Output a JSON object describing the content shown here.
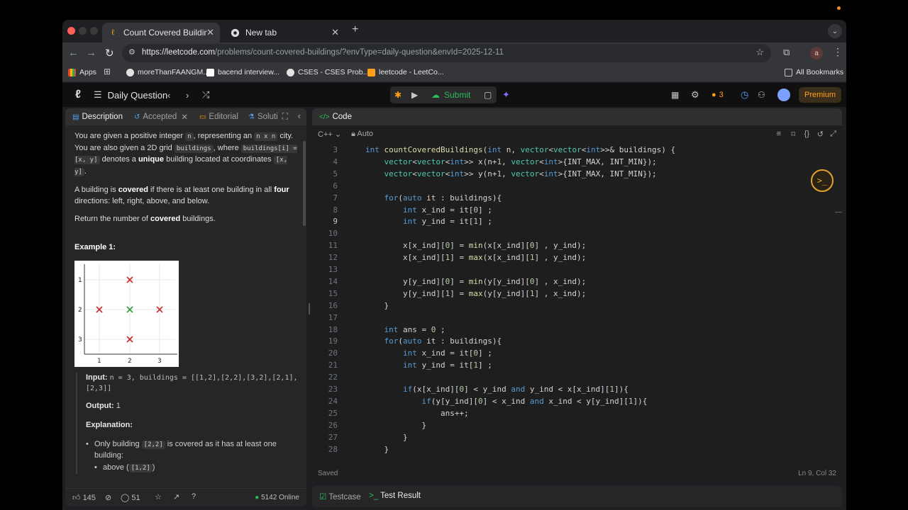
{
  "browser": {
    "tabs": [
      {
        "title": "Count Covered Buildings - Le",
        "active": true
      },
      {
        "title": "New tab",
        "active": false
      }
    ],
    "url_host": "https://leetcode.com",
    "url_path": "/problems/count-covered-buildings/?envType=daily-question&envId=2025-12-11",
    "profile_initial": "a",
    "bookmarks": [
      {
        "label": "Apps"
      },
      {
        "label": "moreThanFAANGM..."
      },
      {
        "label": "bacend interview..."
      },
      {
        "label": "CSES - CSES Prob..."
      },
      {
        "label": "leetcode - LeetCo..."
      }
    ],
    "all_bookmarks": "All Bookmarks"
  },
  "header": {
    "daily_label": "Daily Question",
    "submit_label": "Submit",
    "streak": "3",
    "premium_label": "Premium"
  },
  "left": {
    "tabs": {
      "description": "Description",
      "accepted": "Accepted",
      "editorial": "Editorial",
      "solutions": "Soluti"
    },
    "p1": {
      "t1": "You are given a positive integer ",
      "c1": "n",
      "t2": ", representing an ",
      "c2": "n x n",
      "t3": " city. You are also given a 2D grid ",
      "c3": "buildings",
      "t4": ", where ",
      "c4": "buildings[i] = [x, y]",
      "t5": " denotes a ",
      "b1": "unique",
      "t6": " building located at coordinates ",
      "c5": "[x, y]",
      "t7": "."
    },
    "p2": {
      "t1": "A building is ",
      "b1": "covered",
      "t2": " if there is at least one building in all ",
      "b2": "four",
      "t3": " directions: left, right, above, and below."
    },
    "p3": {
      "t1": "Return the number of ",
      "b1": "covered",
      "t2": " buildings."
    },
    "example_title": "Example 1:",
    "figure": {
      "x_ticks": [
        "1",
        "2",
        "3"
      ],
      "y_ticks": [
        "1",
        "2",
        "3"
      ],
      "covered_color": "#2e9e3a",
      "uncovered_color": "#cc2a2a"
    },
    "input_label": "Input:",
    "input_value": "n = 3, buildings = [[1,2],[2,2],[3,2],[2,1],[2,3]]",
    "output_label": "Output:",
    "output_value": "1",
    "explanation_label": "Explanation:",
    "bullet1_a": "Only building ",
    "bullet1_code": "[2,2]",
    "bullet1_b": " is covered as it has at least one building:",
    "sub1_a": "above (",
    "sub1_code": "[1,2]",
    "sub1_b": ")",
    "footer": {
      "likes": "145",
      "comments": "51",
      "online": "5142 Online"
    }
  },
  "editor": {
    "title": "Code",
    "language": "C++",
    "mode": "Auto",
    "saved": "Saved",
    "cursor": "Ln 9, Col 32",
    "lines": [
      {
        "n": "3",
        "code": "int countCoveredBuildings(int n, vector<vector<int>>& buildings) {"
      },
      {
        "n": "4",
        "code": "    vector<vector<int>> x(n+1, vector<int>{INT_MAX, INT_MIN});"
      },
      {
        "n": "5",
        "code": "    vector<vector<int>> y(n+1, vector<int>{INT_MAX, INT_MIN});"
      },
      {
        "n": "6",
        "code": ""
      },
      {
        "n": "7",
        "code": "    for(auto it : buildings){"
      },
      {
        "n": "8",
        "code": "        int x_ind = it[0] ;"
      },
      {
        "n": "9",
        "code": "        int y_ind = it[1] ;"
      },
      {
        "n": "10",
        "code": ""
      },
      {
        "n": "11",
        "code": "        x[x_ind][0] = min(x[x_ind][0] , y_ind);"
      },
      {
        "n": "12",
        "code": "        x[x_ind][1] = max(x[x_ind][1] , y_ind);"
      },
      {
        "n": "13",
        "code": ""
      },
      {
        "n": "14",
        "code": "        y[y_ind][0] = min(y[y_ind][0] , x_ind);"
      },
      {
        "n": "15",
        "code": "        y[y_ind][1] = max(y[y_ind][1] , x_ind);"
      },
      {
        "n": "16",
        "code": "    }"
      },
      {
        "n": "17",
        "code": ""
      },
      {
        "n": "18",
        "code": "    int ans = 0 ;"
      },
      {
        "n": "19",
        "code": "    for(auto it : buildings){"
      },
      {
        "n": "20",
        "code": "        int x_ind = it[0] ;"
      },
      {
        "n": "21",
        "code": "        int y_ind = it[1] ;"
      },
      {
        "n": "22",
        "code": ""
      },
      {
        "n": "23",
        "code": "        if(x[x_ind][0] < y_ind and y_ind < x[x_ind][1]){"
      },
      {
        "n": "24",
        "code": "            if(y[y_ind][0] < x_ind and x_ind < y[y_ind][1]){"
      },
      {
        "n": "25",
        "code": "                ans++;"
      },
      {
        "n": "26",
        "code": "            }"
      },
      {
        "n": "27",
        "code": "        }"
      },
      {
        "n": "28",
        "code": "    }"
      }
    ]
  },
  "bottom": {
    "testcase": "Testcase",
    "test_result": "Test Result"
  },
  "colors": {
    "accent_green": "#2cbb5d",
    "premium": "#ffa116",
    "streak": "#ffa116"
  }
}
